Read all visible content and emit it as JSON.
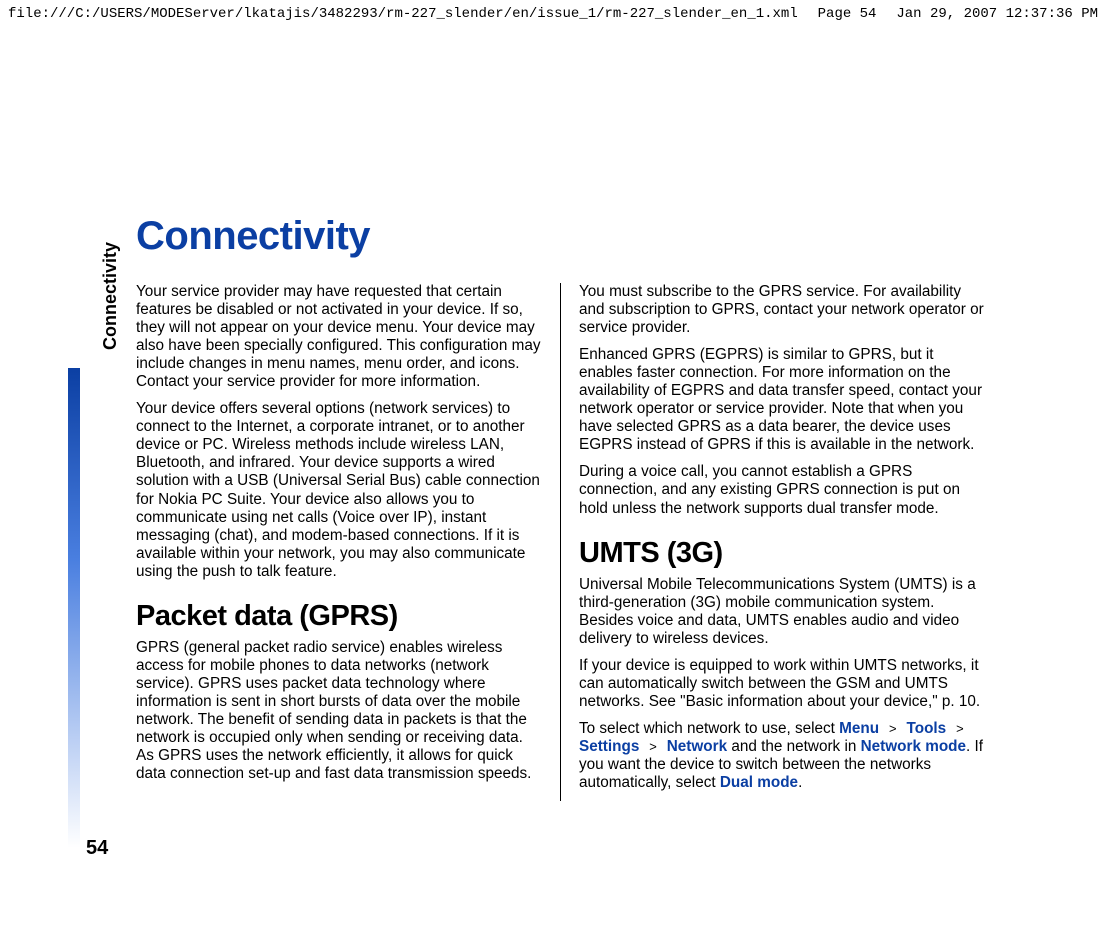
{
  "header": {
    "path": "file:///C:/USERS/MODEServer/lkatajis/3482293/rm-227_slender/en/issue_1/rm-227_slender_en_1.xml",
    "page_label": "Page 54",
    "timestamp": "Jan 29, 2007 12:37:36 PM"
  },
  "sidebar": {
    "section_label": "Connectivity",
    "page_number": "54"
  },
  "body": {
    "title": "Connectivity",
    "left": {
      "p1": "Your service provider may have requested that certain features be disabled or not activated in your device. If so, they will not appear on your device menu. Your device may also have been specially configured. This configuration may include changes in menu names, menu order, and icons. Contact your service provider for more information.",
      "p2": "Your device offers several options (network services) to connect to the Internet, a corporate intranet, or to another device or PC. Wireless methods include wireless LAN, Bluetooth, and infrared. Your device supports a wired solution with a USB (Universal Serial Bus) cable connection for Nokia PC Suite. Your device also allows you to communicate using net calls (Voice over IP), instant messaging (chat), and modem-based connections. If it is available within your network, you may also communicate using the push to talk feature.",
      "h_gprs": "Packet data (GPRS)",
      "p3": "GPRS (general packet radio service) enables wireless access for mobile phones to data networks (network service). GPRS uses packet data technology where information is sent in short bursts of data over the mobile network. The benefit of sending data in packets is that the network is occupied only when sending or receiving data. As GPRS uses the network efficiently, it allows for quick data connection set-up and fast data transmission speeds."
    },
    "right": {
      "p1": "You must subscribe to the GPRS service. For availability and subscription to GPRS, contact your network operator or service provider.",
      "p2": "Enhanced GPRS (EGPRS) is similar to GPRS, but it enables faster connection. For more information on the availability of EGPRS and data transfer speed, contact your network operator or service provider. Note that when you have selected GPRS as a data bearer, the device uses EGPRS instead of GPRS if this is available in the network.",
      "p3": "During a voice call, you cannot establish a GPRS connection, and any existing GPRS connection is put on hold unless the network supports dual transfer mode.",
      "h_umts": "UMTS (3G)",
      "p4": "Universal Mobile Telecommunications System (UMTS) is a third-generation (3G) mobile communication system. Besides voice and data, UMTS enables audio and video delivery to wireless devices.",
      "p5": "If your device is equipped to work within UMTS networks, it can automatically switch between the GSM and UMTS networks. See \"Basic information about your device,\" p. 10.",
      "p6_pre": "To select which network to use, select ",
      "nav_menu": "Menu",
      "nav_tools": "Tools",
      "nav_settings": "Settings",
      "nav_network": "Network",
      "p6_mid": " and the network in ",
      "network_mode": "Network mode",
      "p6_mid2": ". If you want the device to switch between the networks automatically, select ",
      "dual_mode": "Dual mode",
      "p6_end": "."
    }
  }
}
